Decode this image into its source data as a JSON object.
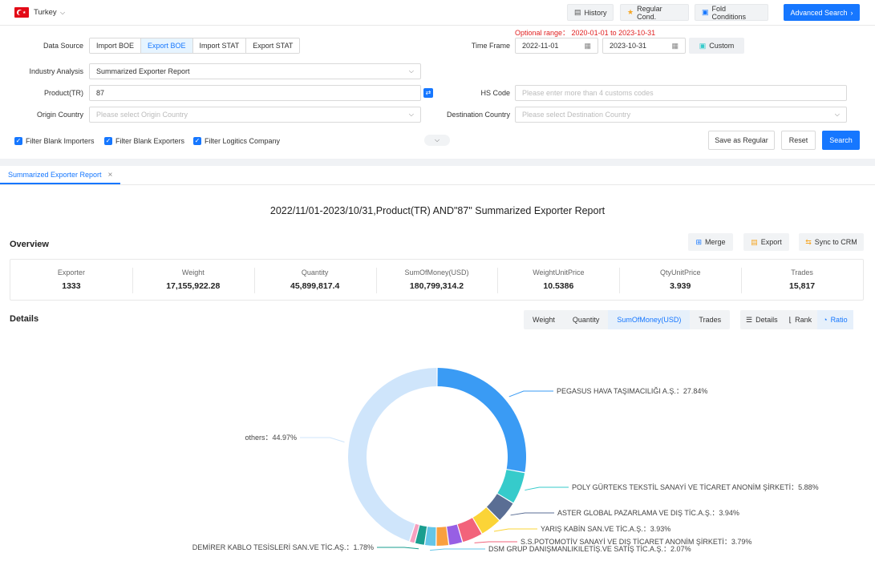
{
  "topbar": {
    "country": "Turkey",
    "history_label": "History",
    "regular_cond_label": "Regular Cond.",
    "fold_conditions_label": "Fold Conditions",
    "advanced_search_label": "Advanced Search"
  },
  "form": {
    "data_source_label": "Data Source",
    "data_sources": [
      "Import BOE",
      "Export BOE",
      "Import STAT",
      "Export STAT"
    ],
    "time_frame_label": "Time Frame",
    "optional_range": "Optional range： 2020-01-01 to 2023-10-31",
    "date_start": "2022-11-01",
    "date_end": "2023-10-31",
    "custom_label": "Custom",
    "industry_analysis_label": "Industry Analysis",
    "industry_analysis_value": "Summarized Exporter Report",
    "product_label": "Product(TR)",
    "product_value": "87",
    "hs_code_label": "HS Code",
    "hs_code_placeholder": "Please enter more than 4 customs codes",
    "origin_country_label": "Origin Country",
    "origin_country_placeholder": "Please select Origin Country",
    "destination_country_label": "Destination Country",
    "destination_country_placeholder": "Please select Destination Country",
    "filter_blank_importers": "Filter Blank Importers",
    "filter_blank_exporters": "Filter Blank Exporters",
    "filter_logistics": "Filter Logitics Company",
    "save_regular_label": "Save as Regular",
    "reset_label": "Reset",
    "search_label": "Search"
  },
  "tab": {
    "label": "Summarized Exporter Report"
  },
  "report": {
    "title": "2022/11/01-2023/10/31,Product(TR) AND\"87\" Summarized Exporter Report",
    "overview_label": "Overview",
    "merge_label": "Merge",
    "export_label": "Export",
    "sync_label": "Sync to CRM",
    "details_label": "Details"
  },
  "stats": [
    {
      "label": "Exporter",
      "value": "1333"
    },
    {
      "label": "Weight",
      "value": "17,155,922.28"
    },
    {
      "label": "Quantity",
      "value": "45,899,817.4"
    },
    {
      "label": "SumOfMoney(USD)",
      "value": "180,799,314.2"
    },
    {
      "label": "WeightUnitPrice",
      "value": "10.5386"
    },
    {
      "label": "QtyUnitPrice",
      "value": "3.939"
    },
    {
      "label": "Trades",
      "value": "15,817"
    }
  ],
  "metric_tabs": [
    "Weight",
    "Quantity",
    "SumOfMoney(USD)",
    "Trades"
  ],
  "view_tabs": [
    "Details",
    "Rank",
    "Ratio"
  ],
  "colors": {
    "accent": "#1677ff",
    "danger": "#e02020"
  },
  "chart_data": {
    "type": "pie",
    "donut": true,
    "slices": [
      {
        "label": "PEGASUS HAVA TAŞIMACILIĞI A.Ş.：27.84%",
        "value": 27.84,
        "color": "#3a9bf4"
      },
      {
        "label": "POLY GÜRTEKS TEKSTİL SANAYİ VE TİCARET ANONİM ŞİRKETİ：5.88%",
        "value": 5.88,
        "color": "#36cbcb"
      },
      {
        "label": "ASTER GLOBAL PAZARLAMA VE DIŞ TİC.A.Ş.：3.94%",
        "value": 3.94,
        "color": "#5a6e94"
      },
      {
        "label": "YARIŞ KABİN SAN.VE TİC.A.Ş.：3.93%",
        "value": 3.93,
        "color": "#fbd437"
      },
      {
        "label": "S.S.POTOMOTİV SANAYİ VE DIŞ TİCARET ANONİM ŞİRKETİ：3.79%",
        "value": 3.79,
        "color": "#f2637b"
      },
      {
        "label": "",
        "value": 2.5,
        "color": "#975fe4"
      },
      {
        "label": "",
        "value": 2.3,
        "color": "#f9a03f"
      },
      {
        "label": "DSM GRUP DANIŞMANLIKILETİŞ.VE SATIŞ TİC.A.Ş.：2.07%",
        "value": 2.07,
        "color": "#64c6e8"
      },
      {
        "label": "DEMİRER KABLO TESİSLERİ SAN.VE TİC.AŞ.：1.78%",
        "value": 1.78,
        "color": "#1a9e8f"
      },
      {
        "label": "",
        "value": 1.0,
        "color": "#f5a0c0"
      },
      {
        "label": "others：44.97%",
        "value": 44.97,
        "color": "#cfe5fb"
      }
    ]
  }
}
